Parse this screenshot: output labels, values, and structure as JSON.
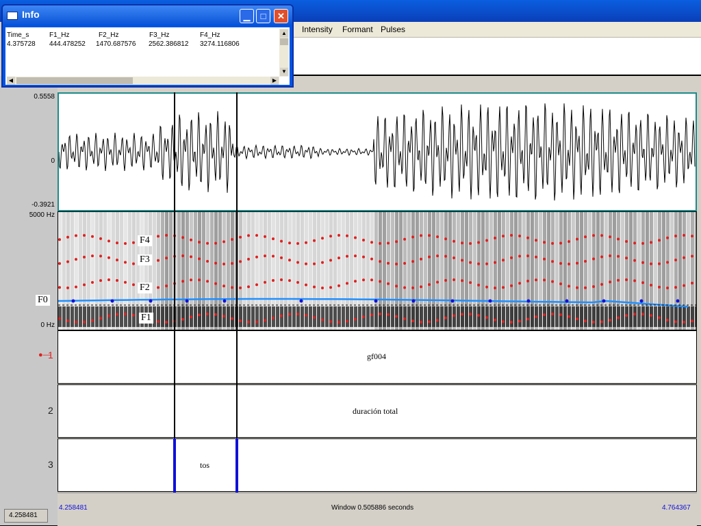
{
  "menu": {
    "intensity": "Intensity",
    "formant": "Formant",
    "pulses": "Pulses"
  },
  "waveform": {
    "ymax": "0.5558",
    "yzero": "0",
    "ymin": "-0.3921"
  },
  "spectrogram": {
    "ymax": "5000 Hz",
    "ymin": "0 Hz",
    "labels": {
      "f4": "F4",
      "f3": "F3",
      "f2": "F2",
      "f1": "F1",
      "f0": "F0"
    }
  },
  "tiers": [
    {
      "number": "1",
      "text": "gf004"
    },
    {
      "number": "2",
      "text": "duración total"
    },
    {
      "number": "3",
      "text": "tos"
    }
  ],
  "bottom": {
    "start_time": "4.258481",
    "window": "Window 0.505886 seconds",
    "end_time": "4.764367",
    "left_time": "4.258481"
  },
  "info_window": {
    "title": "Info",
    "headers": [
      "Time_s",
      "F1_Hz",
      "F2_Hz",
      "F3_Hz",
      "F4_Hz"
    ],
    "values": [
      "4.375728",
      "444.478252",
      "1470.687576",
      "2562.386812",
      "3274.116806"
    ]
  },
  "colors": {
    "formant_dots": "#e02020",
    "pitch_line": "#1f8fff",
    "cursor_blue": "#1010d8",
    "xp_blue": "#0054e3"
  }
}
